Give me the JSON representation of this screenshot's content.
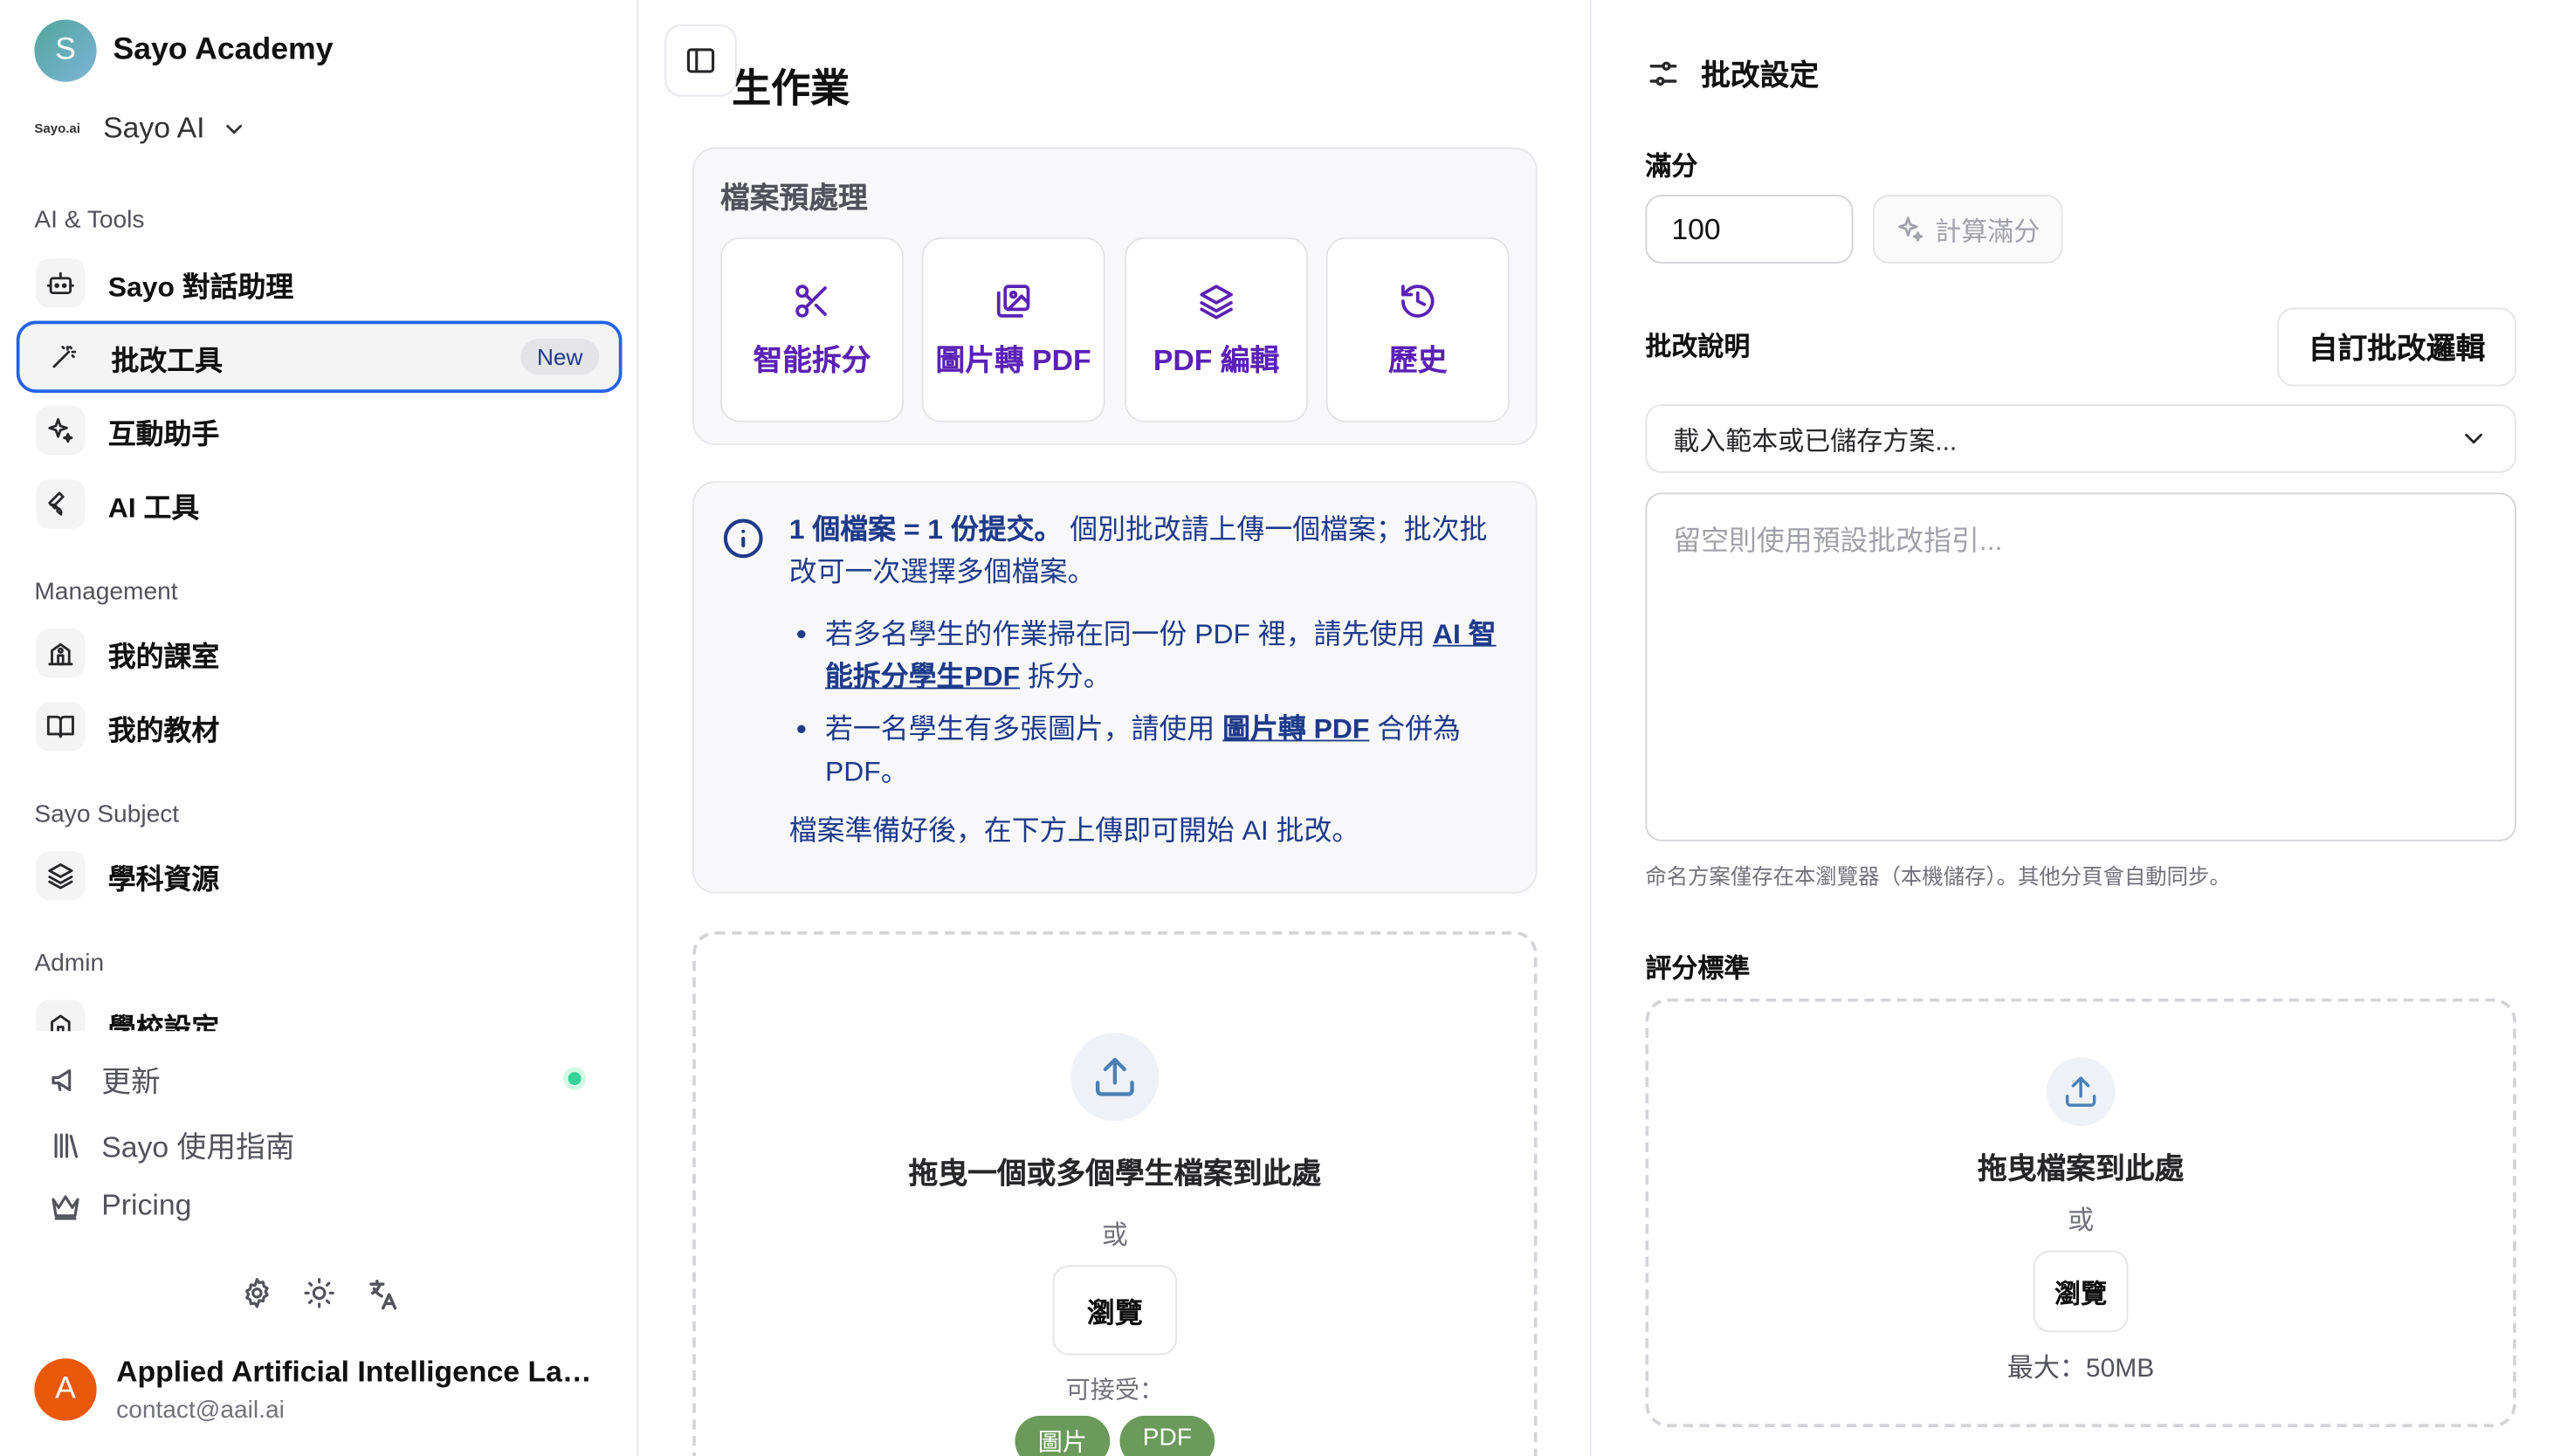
{
  "sidebar": {
    "brand": {
      "initial": "S",
      "name": "Sayo Academy"
    },
    "org": {
      "logo_text": "Sayo.ai",
      "name": "Sayo AI"
    },
    "sections": {
      "ai_tools": "AI & Tools",
      "management": "Management",
      "subject": "Sayo Subject",
      "admin": "Admin"
    },
    "items": {
      "chat": "Sayo 對話助理",
      "grading": "批改工具",
      "grading_badge": "New",
      "interactive": "互動助手",
      "ai_tools": "AI 工具",
      "classroom": "我的課室",
      "materials": "我的教材",
      "subject_resources": "學科資源",
      "school_settings": "學校設定"
    },
    "footer_links": {
      "updates": "更新",
      "guide": "Sayo 使用指南",
      "pricing": "Pricing"
    },
    "user": {
      "initial": "A",
      "name": "Applied Artificial Intelligence Lab...",
      "email": "contact@aail.ai"
    }
  },
  "main": {
    "title": "生作業",
    "prep": {
      "title": "檔案預處理",
      "tools": [
        "智能拆分",
        "圖片轉 PDF",
        "PDF 編輯",
        "歷史"
      ]
    },
    "info": {
      "bold": "1 個檔案 = 1 份提交。",
      "text": " 個別批改請上傳一個檔案；批次批改可一次選擇多個檔案。",
      "bullet1_pre": "若多名學生的作業掃在同一份 PDF 裡，請先使用 ",
      "bullet1_link": "AI 智能拆分學生PDF",
      "bullet1_post": " 拆分。",
      "bullet2_pre": "若一名學生有多張圖片，請使用 ",
      "bullet2_link": "圖片轉 PDF",
      "bullet2_post": " 合併為 PDF。",
      "footer": "檔案準備好後，在下方上傳即可開始 AI 批改。"
    },
    "upload": {
      "title": "拖曳一個或多個學生檔案到此處",
      "or": "或",
      "browse": "瀏覽",
      "accept": "可接受：",
      "types": [
        "圖片",
        "PDF"
      ]
    }
  },
  "settings": {
    "title": "批改設定",
    "full_score_label": "滿分",
    "full_score_value": "100",
    "calc_button": "計算滿分",
    "instructions_label": "批改說明",
    "custom_logic_button": "自訂批改邏輯",
    "preset_select": "載入範本或已儲存方案...",
    "instructions_placeholder": "留空則使用預設批改指引...",
    "help": "命名方案僅存在本瀏覽器（本機儲存）。其他分頁會自動同步。",
    "rubric_label": "評分標準",
    "rubric_drop_title": "拖曳檔案到此處",
    "rubric_or": "或",
    "rubric_browse": "瀏覽",
    "rubric_max": "最大：50MB"
  }
}
